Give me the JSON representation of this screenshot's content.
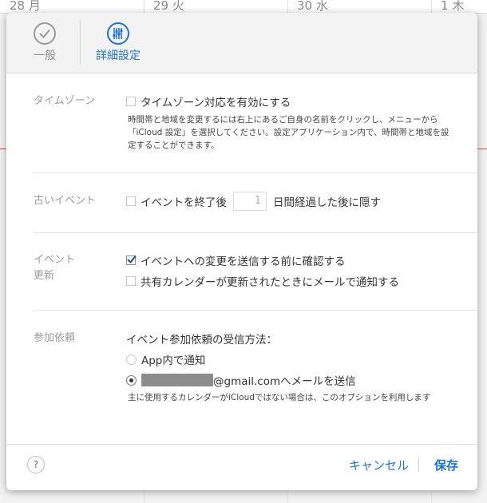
{
  "calendar_background": {
    "days": [
      {
        "number": "28",
        "weekday": "月"
      },
      {
        "number": "29",
        "weekday": "火"
      },
      {
        "number": "30",
        "weekday": "水"
      },
      {
        "number": "1",
        "weekday": "木"
      }
    ]
  },
  "tabs": {
    "general": "一般",
    "advanced": "詳細設定"
  },
  "timezone": {
    "label": "タイムゾーン",
    "checkbox": "タイムゾーン対応を有効にする",
    "checked": false,
    "description_line1": "時間帯と地域を変更するには右上にあるご自身の名前をクリックし、メニューから",
    "description_line2": "「iCloud 設定」を選択してください。設定アプリケーション内で、時間帯と地域を設",
    "description_line3": "定することができます。"
  },
  "old_events": {
    "label": "古いイベント",
    "checkbox": "イベントを終了後",
    "checked": false,
    "days_value": "1",
    "suffix": "日間経過した後に隠す"
  },
  "event_updates": {
    "label_line1": "イベント",
    "label_line2": "更新",
    "confirm_checkbox": "イベントへの変更を送信する前に確認する",
    "confirm_checked": true,
    "email_checkbox": "共有カレンダーが更新されたときにメールで通知する",
    "email_checked": false
  },
  "invitations": {
    "label": "参加依頼",
    "heading": "イベント参加依頼の受信方法：",
    "option_app": "App内で通知",
    "option_email_suffix": "@gmail.comへメールを送信",
    "selected": "email",
    "note": "主に使用するカレンダーがiCloudではない場合は、このオプションを利用します"
  },
  "footer": {
    "help": "?",
    "cancel": "キャンセル",
    "save": "保存"
  },
  "colors": {
    "accent": "#1a73d9",
    "current_time_line": "#e14b4b"
  }
}
